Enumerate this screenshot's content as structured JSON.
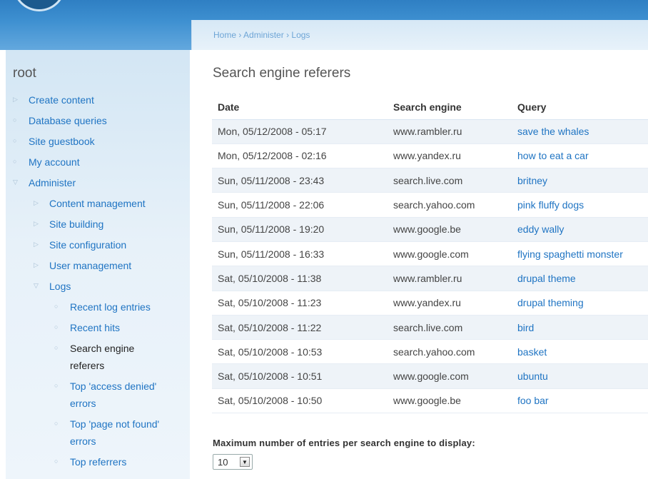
{
  "breadcrumb": [
    "Home",
    "Administer",
    "Logs"
  ],
  "breadcrumb_sep": "›",
  "sidebar": {
    "title": "root",
    "items": [
      {
        "label": "Create content",
        "level": 0,
        "bullet": "▷"
      },
      {
        "label": "Database queries",
        "level": 0,
        "bullet": "○"
      },
      {
        "label": "Site guestbook",
        "level": 0,
        "bullet": "○"
      },
      {
        "label": "My account",
        "level": 0,
        "bullet": "○"
      },
      {
        "label": "Administer",
        "level": 0,
        "bullet": "▽"
      },
      {
        "label": "Content management",
        "level": 1,
        "bullet": "▷"
      },
      {
        "label": "Site building",
        "level": 1,
        "bullet": "▷"
      },
      {
        "label": "Site configuration",
        "level": 1,
        "bullet": "▷"
      },
      {
        "label": "User management",
        "level": 1,
        "bullet": "▷"
      },
      {
        "label": "Logs",
        "level": 1,
        "bullet": "▽"
      },
      {
        "label": "Recent log entries",
        "level": 2,
        "bullet": "○"
      },
      {
        "label": "Recent hits",
        "level": 2,
        "bullet": "○"
      },
      {
        "label": "Search engine referers",
        "level": 2,
        "bullet": "○",
        "active": true
      },
      {
        "label": "Top 'access denied' errors",
        "level": 2,
        "bullet": "○"
      },
      {
        "label": "Top 'page not found' errors",
        "level": 2,
        "bullet": "○"
      },
      {
        "label": "Top referrers",
        "level": 2,
        "bullet": "○"
      }
    ]
  },
  "page_title": "Search engine referers",
  "table": {
    "headers": [
      "Date",
      "Search engine",
      "Query"
    ],
    "rows": [
      [
        "Mon, 05/12/2008 - 05:17",
        "www.rambler.ru",
        "save the whales"
      ],
      [
        "Mon, 05/12/2008 - 02:16",
        "www.yandex.ru",
        "how to eat a car"
      ],
      [
        "Sun, 05/11/2008 - 23:43",
        "search.live.com",
        "britney"
      ],
      [
        "Sun, 05/11/2008 - 22:06",
        "search.yahoo.com",
        "pink fluffy dogs"
      ],
      [
        "Sun, 05/11/2008 - 19:20",
        "www.google.be",
        "eddy wally"
      ],
      [
        "Sun, 05/11/2008 - 16:33",
        "www.google.com",
        "flying spaghetti monster"
      ],
      [
        "Sat, 05/10/2008 - 11:38",
        "www.rambler.ru",
        "drupal theme"
      ],
      [
        "Sat, 05/10/2008 - 11:23",
        "www.yandex.ru",
        "drupal theming"
      ],
      [
        "Sat, 05/10/2008 - 11:22",
        "search.live.com",
        "bird"
      ],
      [
        "Sat, 05/10/2008 - 10:53",
        "search.yahoo.com",
        "basket"
      ],
      [
        "Sat, 05/10/2008 - 10:51",
        "www.google.com",
        "ubuntu"
      ],
      [
        "Sat, 05/10/2008 - 10:50",
        "www.google.be",
        "foo bar"
      ]
    ]
  },
  "limit": {
    "label": "Maximum number of entries per search engine to display:",
    "value": "10",
    "arrow": "▼"
  },
  "colors": {
    "link": "#1f74c3",
    "header_blue": "#3d8fd0",
    "sidebar_bg": "#e7f1f9"
  }
}
